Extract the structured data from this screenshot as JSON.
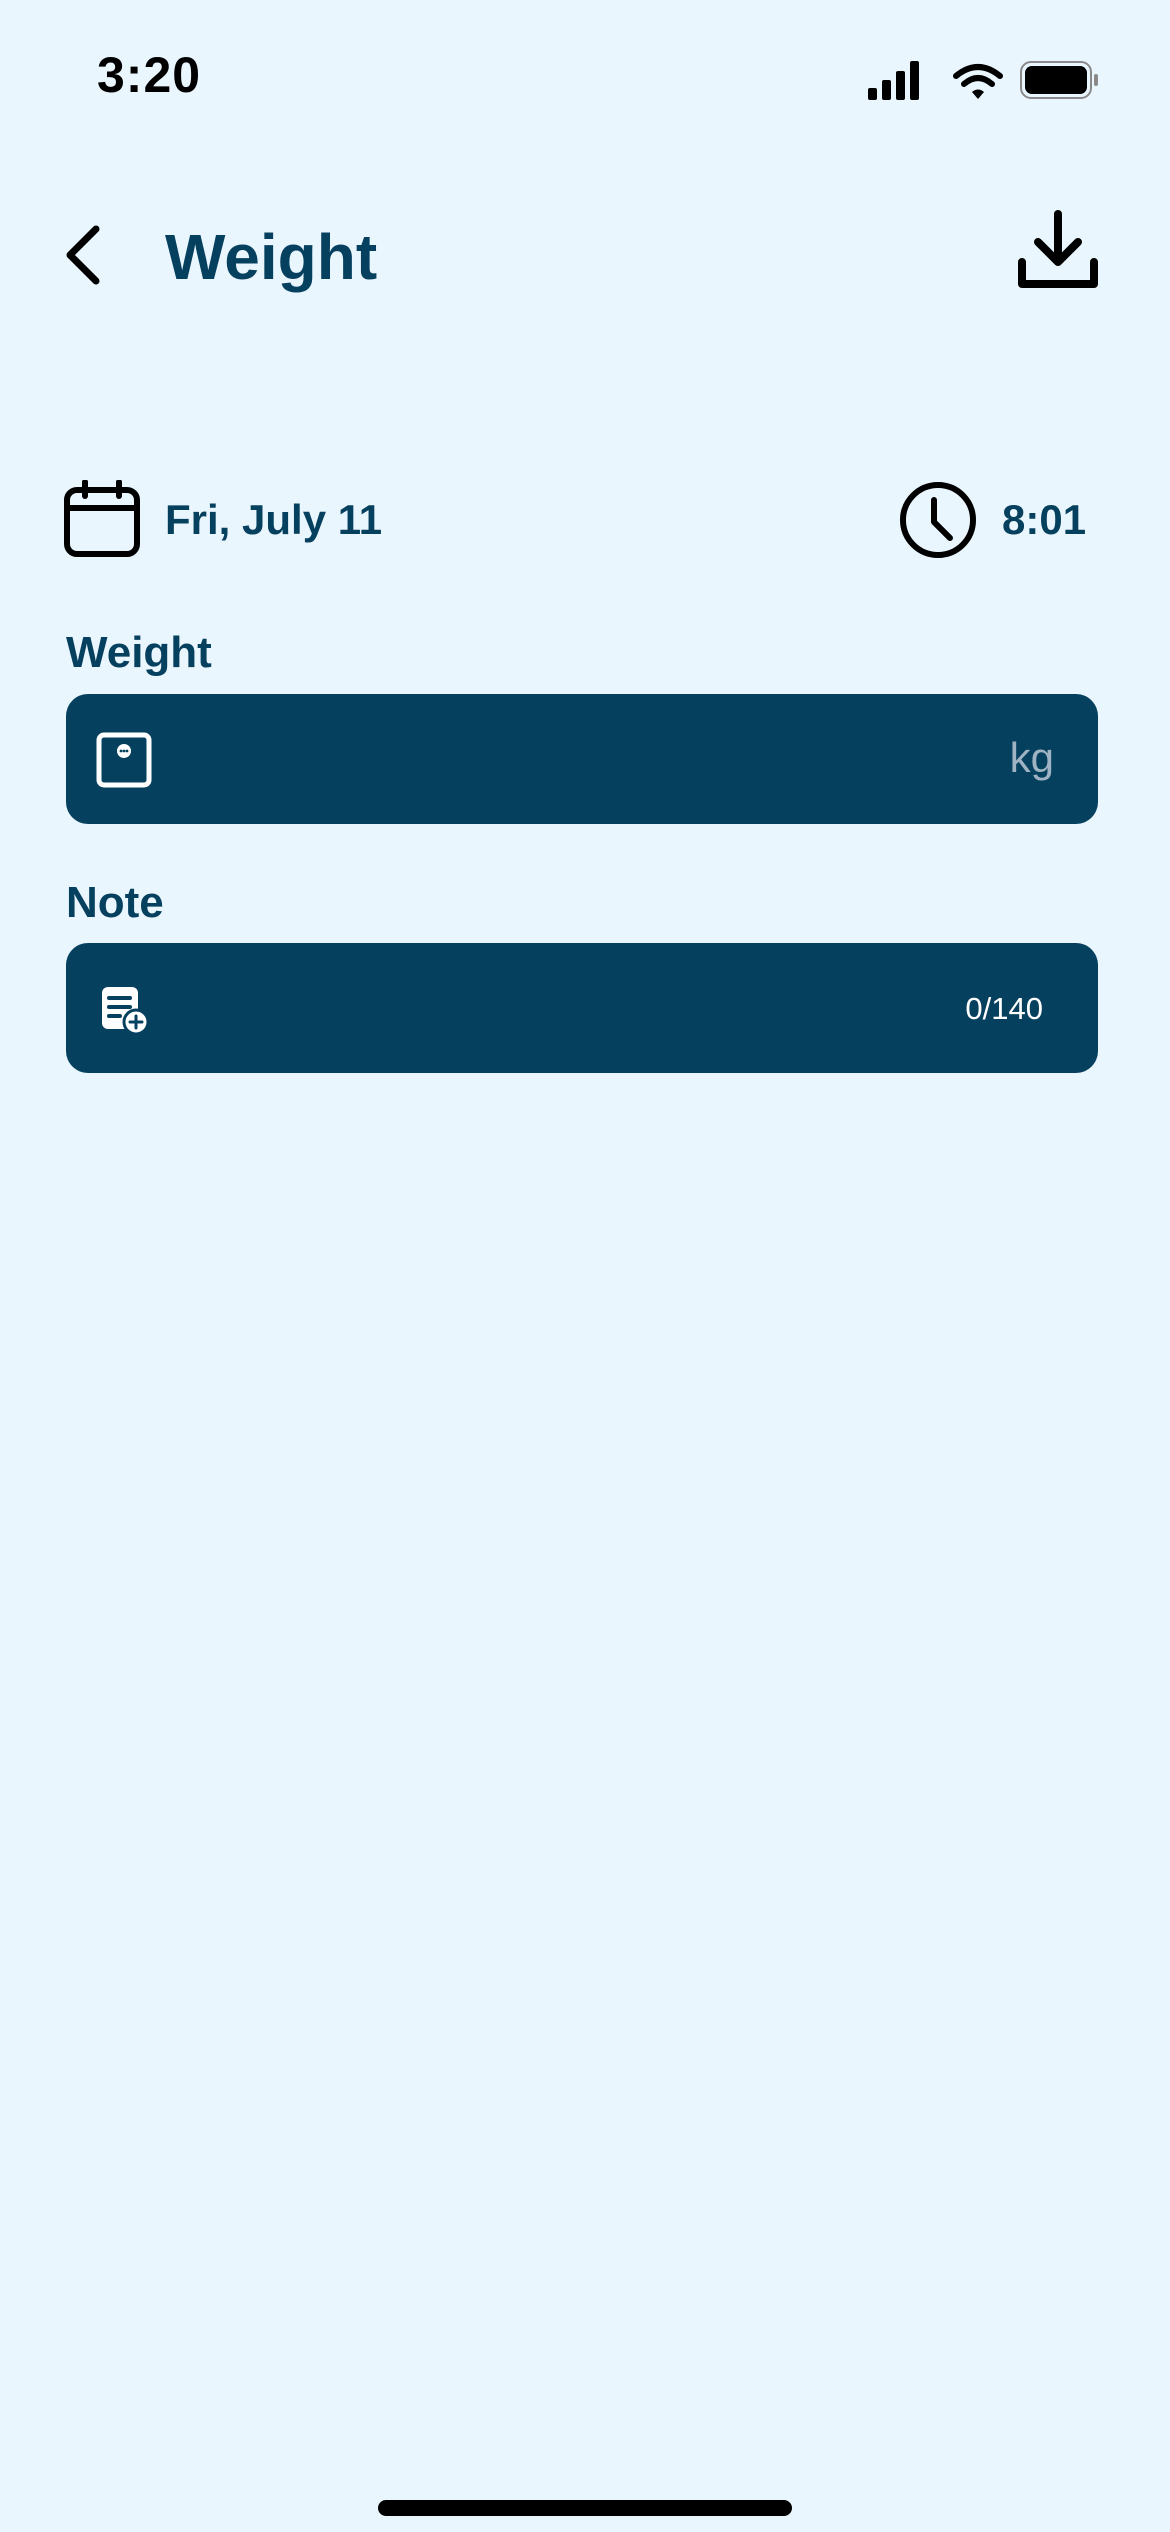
{
  "status_bar": {
    "time": "3:20",
    "icons": [
      "cellular-signal-icon",
      "wifi-icon",
      "battery-icon"
    ]
  },
  "header": {
    "title": "Weight",
    "back_icon": "chevron-left-icon",
    "action_icon": "download-icon"
  },
  "datetime": {
    "date": "Fri, July 11",
    "time": "8:01",
    "date_icon": "calendar-icon",
    "time_icon": "clock-icon"
  },
  "weight": {
    "label": "Weight",
    "value": "",
    "unit": "kg",
    "icon": "scale-icon"
  },
  "note": {
    "label": "Note",
    "value": "",
    "counter": "0/140",
    "icon": "note-add-icon"
  },
  "colors": {
    "background": "#EAF6FE",
    "primary": "#06405F",
    "unit_text": "#9FB3C3"
  }
}
